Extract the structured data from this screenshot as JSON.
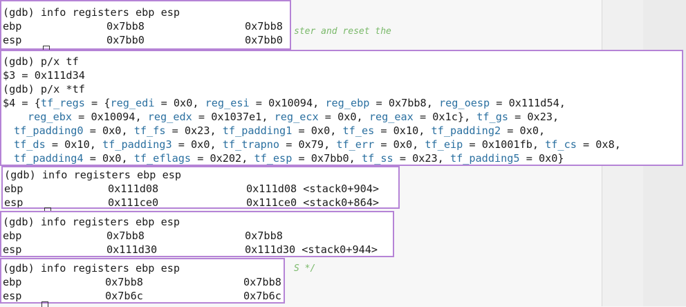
{
  "background": {
    "comment_fragment": "ster and reset the",
    "comment_fragment2": "S */",
    "colors": {
      "editor": "#f7f7f7",
      "box_border": "#b583d6",
      "member": "#2b70a0"
    }
  },
  "box1": {
    "prompt": "(gdb) info registers ebp esp",
    "rows": [
      {
        "reg": "ebp",
        "hex": "0x7bb8",
        "value": "0x7bb8"
      },
      {
        "reg": "esp",
        "hex": "0x7bb0",
        "value": "0x7bb0"
      }
    ]
  },
  "box2": {
    "cmd1": "(gdb) p/x tf",
    "out1": "$3 = 0x111d34",
    "cmd2": "(gdb) p/x *tf",
    "struct": {
      "l1_prefix": "$4 = {",
      "l1_a": "tf_regs",
      "l1_b": " = {",
      "l1_c": "reg_edi",
      "l1_d": " = 0x0, ",
      "l1_e": "reg_esi",
      "l1_f": " = 0x10094, ",
      "l1_g": "reg_ebp",
      "l1_h": " = 0x7bb8, ",
      "l1_i": "reg_oesp",
      "l1_j": " = 0x111d54,",
      "l2_a": "reg_ebx",
      "l2_b": " = 0x10094, ",
      "l2_c": "reg_edx",
      "l2_d": " = 0x1037e1, ",
      "l2_e": "reg_ecx",
      "l2_f": " = 0x0, ",
      "l2_g": "reg_eax",
      "l2_h": " = 0x1c}, ",
      "l2_i": "tf_gs",
      "l2_j": " = 0x23,",
      "l3_a": "tf_padding0",
      "l3_b": " = 0x0, ",
      "l3_c": "tf_fs",
      "l3_d": " = 0x23, ",
      "l3_e": "tf_padding1",
      "l3_f": " = 0x0, ",
      "l3_g": "tf_es",
      "l3_h": " = 0x10, ",
      "l3_i": "tf_padding2",
      "l3_j": " = 0x0,",
      "l4_a": "tf_ds",
      "l4_b": " = 0x10, ",
      "l4_c": "tf_padding3",
      "l4_d": " = 0x0, ",
      "l4_e": "tf_trapno",
      "l4_f": " = 0x79, ",
      "l4_g": "tf_err",
      "l4_h": " = 0x0, ",
      "l4_i": "tf_eip",
      "l4_j": " = 0x1001fb, ",
      "l4_k": "tf_cs",
      "l4_l": " = 0x8,",
      "l5_a": "tf_padding4",
      "l5_b": " = 0x0, ",
      "l5_c": "tf_eflags",
      "l5_d": " = 0x202, ",
      "l5_e": "tf_esp",
      "l5_f": " = 0x7bb0, ",
      "l5_g": "tf_ss",
      "l5_h": " = 0x23, ",
      "l5_i": "tf_padding5",
      "l5_j": " = 0x0}"
    }
  },
  "box3": {
    "prompt": "(gdb) info registers ebp esp",
    "rows": [
      {
        "reg": "ebp",
        "hex": "0x111d08",
        "value": "0x111d08 <stack0+904>"
      },
      {
        "reg": "esp",
        "hex": "0x111ce0",
        "value": "0x111ce0 <stack0+864>"
      }
    ]
  },
  "box4": {
    "prompt": "(gdb) info registers ebp esp",
    "rows": [
      {
        "reg": "ebp",
        "hex": "0x7bb8",
        "value": "0x7bb8"
      },
      {
        "reg": "esp",
        "hex": "0x111d30",
        "value": "0x111d30 <stack0+944>"
      }
    ]
  },
  "box5": {
    "prompt": "(gdb) info registers ebp esp",
    "rows": [
      {
        "reg": "ebp",
        "hex": "0x7bb8",
        "value": "0x7bb8"
      },
      {
        "reg": "esp",
        "hex": "0x7b6c",
        "value": "0x7b6c"
      }
    ]
  }
}
